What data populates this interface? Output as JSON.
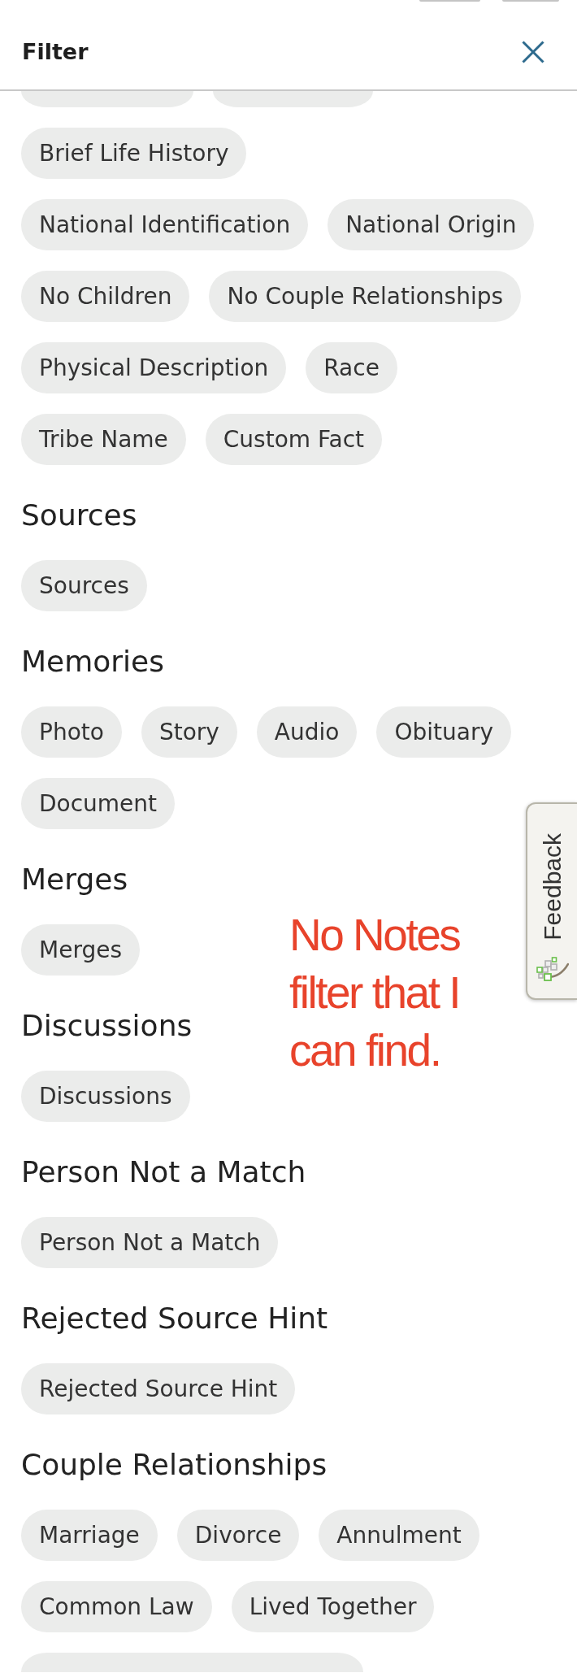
{
  "header": {
    "title": "Filter"
  },
  "sections": [
    {
      "chips": [
        {
          "kind": "cut-top"
        },
        {
          "kind": "cut-top"
        },
        {
          "kind": "chip",
          "label": "Brief Life History",
          "selected": false
        },
        {
          "kind": "chip",
          "label": "National Identification",
          "selected": false
        },
        {
          "kind": "chip",
          "label": "National Origin",
          "selected": false
        },
        {
          "kind": "chip",
          "label": "No Children",
          "selected": false
        },
        {
          "kind": "chip",
          "label": "No Couple Relationships",
          "selected": false
        },
        {
          "kind": "chip",
          "label": "Physical Description",
          "selected": false
        },
        {
          "kind": "chip",
          "label": "Race",
          "selected": false
        },
        {
          "kind": "chip",
          "label": "Tribe Name",
          "selected": false
        },
        {
          "kind": "chip",
          "label": "Custom Fact",
          "selected": false
        }
      ]
    },
    {
      "heading": "Sources",
      "chips": [
        {
          "kind": "chip",
          "label": "Sources",
          "selected": false
        }
      ]
    },
    {
      "heading": "Memories",
      "chips": [
        {
          "kind": "chip",
          "label": "Photo",
          "selected": false
        },
        {
          "kind": "chip",
          "label": "Story",
          "selected": false
        },
        {
          "kind": "chip",
          "label": "Audio",
          "selected": false
        },
        {
          "kind": "chip",
          "label": "Obituary",
          "selected": false
        },
        {
          "kind": "chip",
          "label": "Document",
          "selected": false
        }
      ]
    },
    {
      "heading": "Merges",
      "chips": [
        {
          "kind": "chip",
          "label": "Merges",
          "selected": false
        }
      ]
    },
    {
      "heading": "Discussions",
      "chips": [
        {
          "kind": "chip",
          "label": "Discussions",
          "selected": false
        }
      ]
    },
    {
      "heading": "Person Not a Match",
      "chips": [
        {
          "kind": "chip",
          "label": "Person Not a Match",
          "selected": false
        }
      ]
    },
    {
      "heading": "Rejected Source Hint",
      "chips": [
        {
          "kind": "chip",
          "label": "Rejected Source Hint",
          "selected": false
        }
      ]
    },
    {
      "heading": "Couple Relationships",
      "chips": [
        {
          "kind": "chip",
          "label": "Marriage",
          "selected": false
        },
        {
          "kind": "chip",
          "label": "Divorce",
          "selected": false
        },
        {
          "kind": "chip",
          "label": "Annulment",
          "selected": false
        },
        {
          "kind": "chip",
          "label": "Common Law",
          "selected": false
        },
        {
          "kind": "chip",
          "label": "Lived Together",
          "selected": false
        },
        {
          "kind": "cut-bottom"
        }
      ]
    }
  ],
  "annotation": {
    "text": "No Notes filter that I can find."
  },
  "feedback_tab": {
    "label": "Feedback"
  }
}
